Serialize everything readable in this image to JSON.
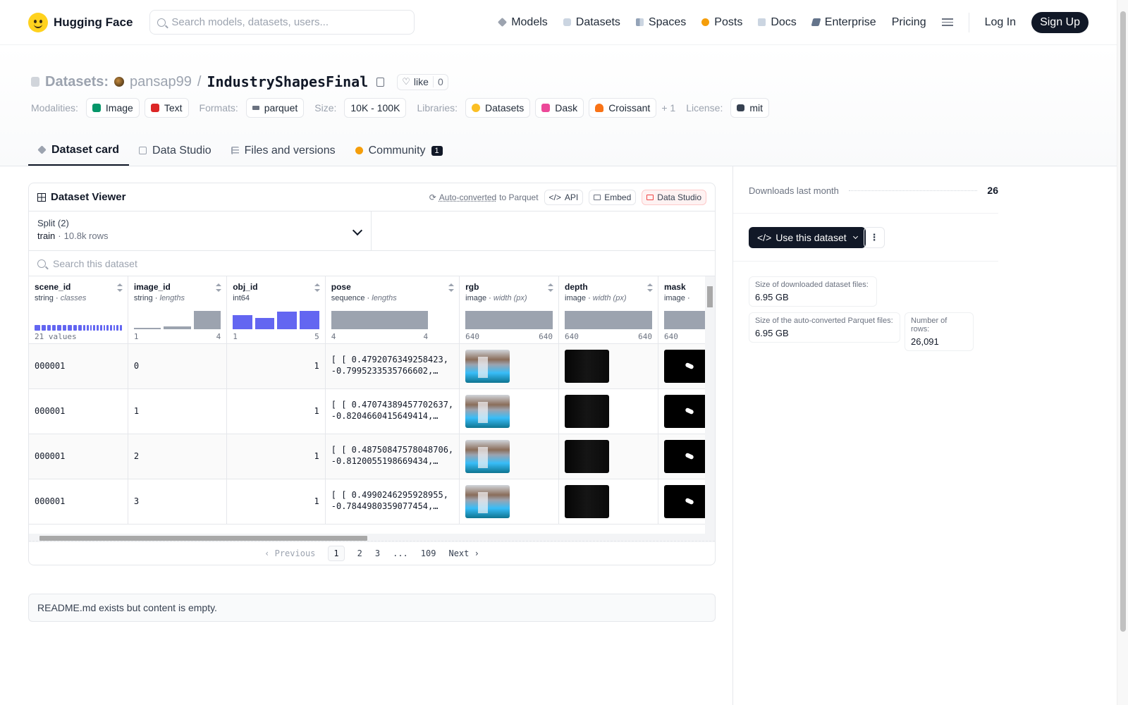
{
  "nav": {
    "brand": "Hugging Face",
    "search_placeholder": "Search models, datasets, users...",
    "links": [
      "Models",
      "Datasets",
      "Spaces",
      "Posts",
      "Docs",
      "Enterprise",
      "Pricing"
    ],
    "login": "Log In",
    "signup": "Sign Up"
  },
  "header": {
    "section": "Datasets:",
    "owner": "pansap99",
    "separator": "/",
    "name": "IndustryShapesFinal",
    "like_label": "like",
    "like_count": "0",
    "modalities_label": "Modalities:",
    "modalities": [
      "Image",
      "Text"
    ],
    "formats_label": "Formats:",
    "format": "parquet",
    "size_label": "Size:",
    "size": "10K - 100K",
    "libraries_label": "Libraries:",
    "libraries": [
      "Datasets",
      "Dask",
      "Croissant"
    ],
    "libraries_more": "+ 1",
    "license_label": "License:",
    "license": "mit"
  },
  "tabs": [
    {
      "label": "Dataset card",
      "icon": "dataset-card-icon"
    },
    {
      "label": "Data Studio",
      "icon": "data-studio-icon"
    },
    {
      "label": "Files and versions",
      "icon": "files-icon"
    },
    {
      "label": "Community",
      "icon": "community-icon",
      "badge": "1"
    }
  ],
  "viewer": {
    "title": "Dataset Viewer",
    "auto_converted": "Auto-converted",
    "to_parquet": "to Parquet",
    "api": "API",
    "embed": "Embed",
    "data_studio": "Data Studio",
    "split_label": "Split (2)",
    "split_value": "train",
    "split_sep": "·",
    "split_rows": "10.8k rows",
    "search_placeholder": "Search this dataset",
    "columns": [
      {
        "name": "scene_id",
        "type": "string",
        "sub": "classes",
        "summary_left": "21 values",
        "summary_right": ""
      },
      {
        "name": "image_id",
        "type": "string",
        "sub": "lengths",
        "summary_left": "1",
        "summary_right": "4"
      },
      {
        "name": "obj_id",
        "type": "int64",
        "sub": "",
        "summary_left": "1",
        "summary_right": "5"
      },
      {
        "name": "pose",
        "type": "sequence",
        "sub": "lengths",
        "summary_left": "4",
        "summary_right": "4"
      },
      {
        "name": "rgb",
        "type": "image",
        "sub": "width (px)",
        "summary_left": "640",
        "summary_right": "640"
      },
      {
        "name": "depth",
        "type": "image",
        "sub": "width (px)",
        "summary_left": "640",
        "summary_right": "640"
      },
      {
        "name": "mask",
        "type": "image",
        "sub": "",
        "summary_left": "640",
        "summary_right": ""
      }
    ],
    "rows": [
      {
        "scene_id": "000001",
        "image_id": "0",
        "obj_id": "1",
        "pose_l1": "[ [ 0.4792076349258423,",
        "pose_l2": "-0.7995233535766602,…"
      },
      {
        "scene_id": "000001",
        "image_id": "1",
        "obj_id": "1",
        "pose_l1": "[ [ 0.47074389457702637,",
        "pose_l2": "-0.8204660415649414,…"
      },
      {
        "scene_id": "000001",
        "image_id": "2",
        "obj_id": "1",
        "pose_l1": "[ [ 0.48750847578048706,",
        "pose_l2": "-0.8120055198669434,…"
      },
      {
        "scene_id": "000001",
        "image_id": "3",
        "obj_id": "1",
        "pose_l1": "[ [ 0.4990246295928955,",
        "pose_l2": "-0.7844980359077454,…"
      }
    ],
    "pager": {
      "prev": "Previous",
      "pages": [
        "1",
        "2",
        "3",
        "...",
        "109"
      ],
      "next": "Next"
    }
  },
  "readme": "README.md exists but content is empty.",
  "sidebar": {
    "downloads_label": "Downloads last month",
    "downloads_value": "26",
    "use_dataset": "Use this dataset",
    "more": "⋮",
    "stats": [
      {
        "label": "Size of downloaded dataset files:",
        "value": "6.95 GB"
      },
      {
        "label": "Size of the auto-converted Parquet files:",
        "value": "6.95 GB"
      },
      {
        "label": "Number of rows:",
        "value": "26,091"
      }
    ]
  }
}
